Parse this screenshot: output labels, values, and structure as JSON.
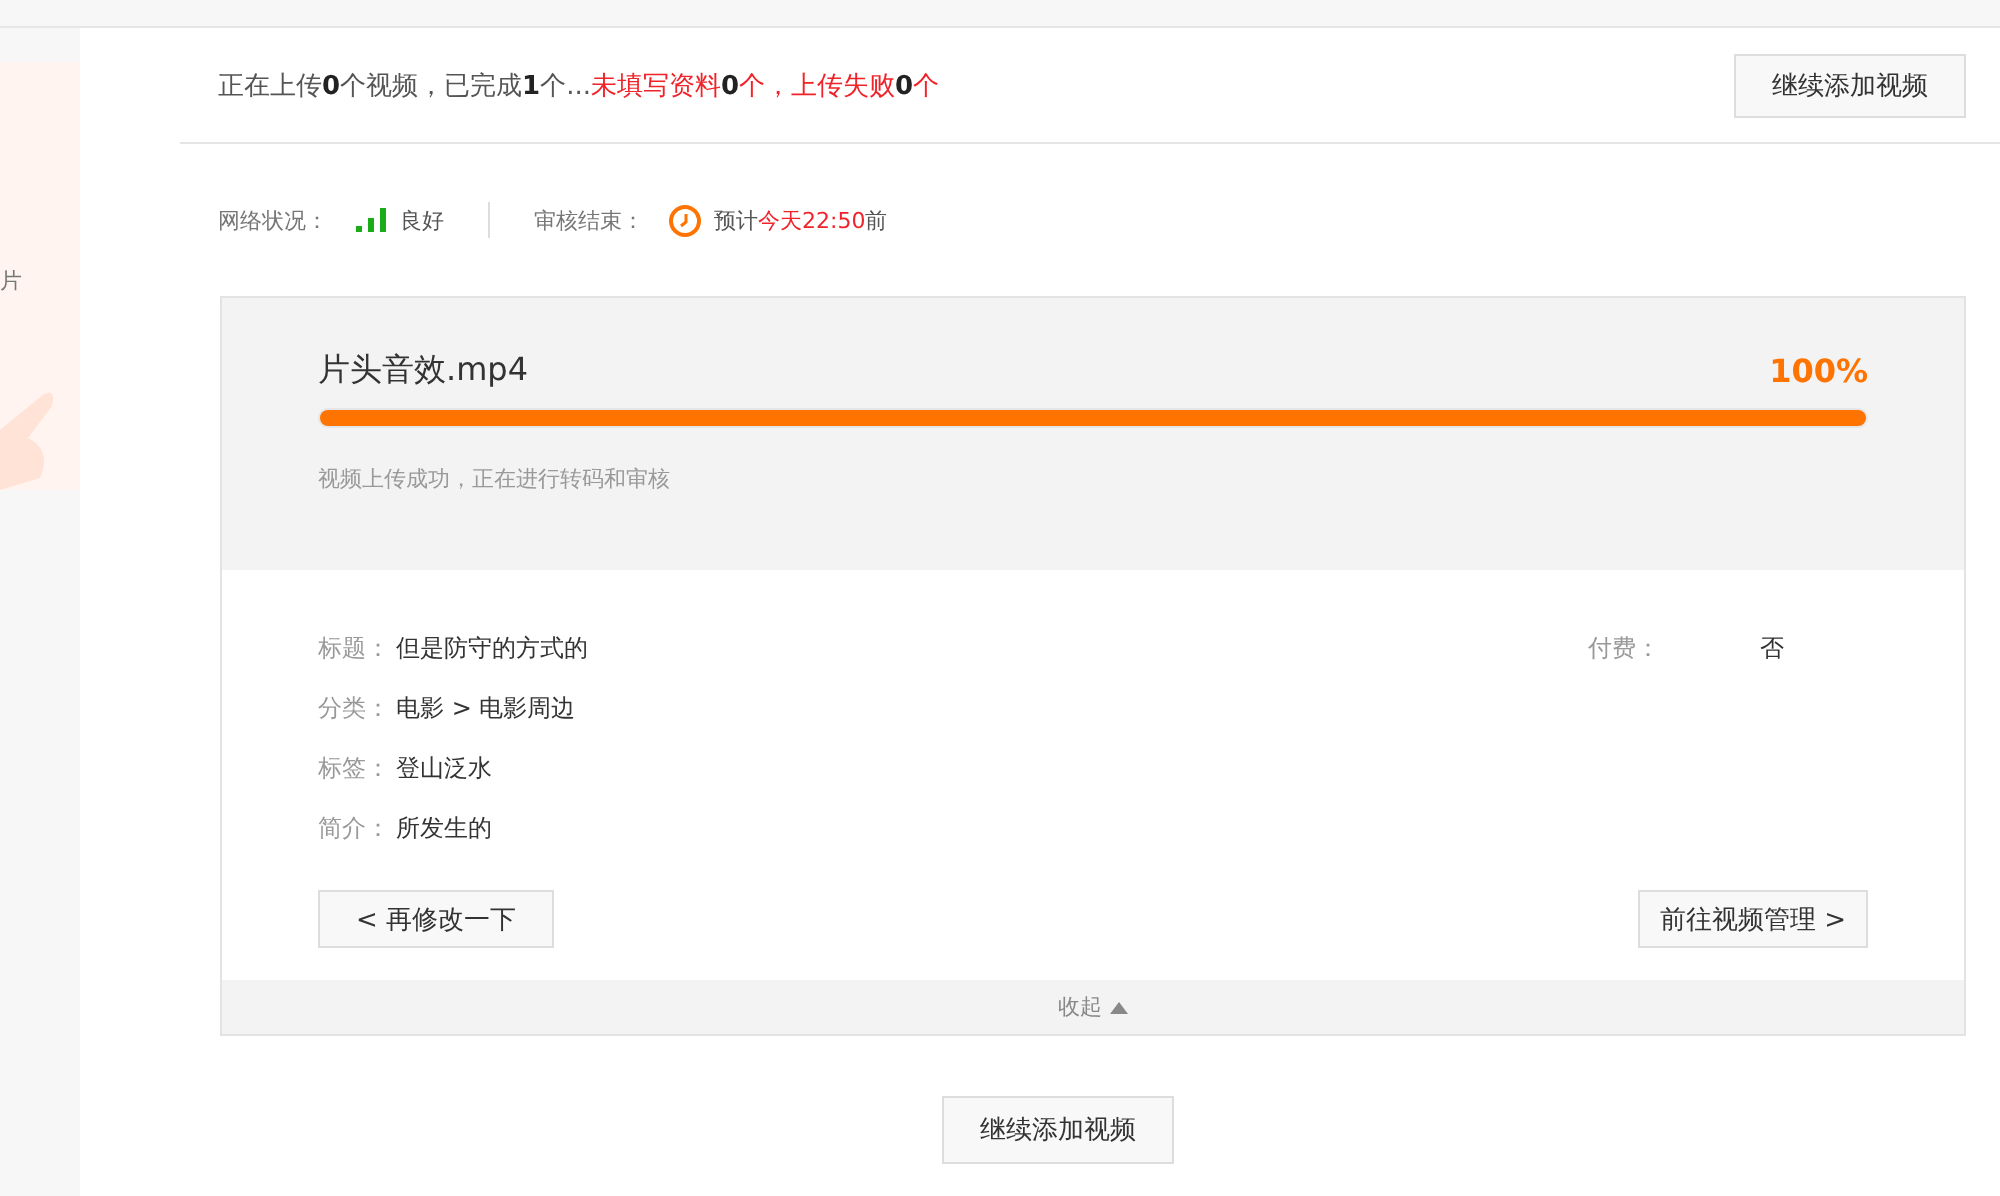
{
  "side_panel": {
    "text": "片"
  },
  "summary": {
    "segments": [
      {
        "text": "正在上传",
        "kind": "normal"
      },
      {
        "text": "0",
        "kind": "count"
      },
      {
        "text": "个视频，已完成",
        "kind": "normal"
      },
      {
        "text": "1",
        "kind": "count"
      },
      {
        "text": "个...",
        "kind": "normal"
      },
      {
        "text": "未填写资料",
        "kind": "alert"
      },
      {
        "text": "0",
        "kind": "count"
      },
      {
        "text": "个，上传失败",
        "kind": "alert"
      },
      {
        "text": "0",
        "kind": "count"
      },
      {
        "text": "个",
        "kind": "alert"
      }
    ],
    "button": "继续添加视频"
  },
  "status": {
    "network_label": "网络状况：",
    "network_value": "良好",
    "review_label": "审核结束：",
    "review_prefix": "预计",
    "review_time": "今天22:50",
    "review_suffix": "前"
  },
  "upload": {
    "filename": "片头音效.mp4",
    "percent": "100%",
    "level": 1,
    "message": "视频上传成功，正在进行转码和审核",
    "fields": [
      {
        "label": "标题：",
        "value": "但是防守的方式的"
      },
      {
        "label": "分类：",
        "value": "电影 > 电影周边"
      },
      {
        "label": "标签：",
        "value": "登山泛水"
      },
      {
        "label": "简介：",
        "value": "所发生的"
      }
    ],
    "paid": {
      "label": "付费：",
      "value": "否"
    },
    "back_button": "< 再修改一下",
    "manage_button": "前往视频管理 >",
    "collapse": "收起"
  },
  "bottom_button": "继续添加视频"
}
